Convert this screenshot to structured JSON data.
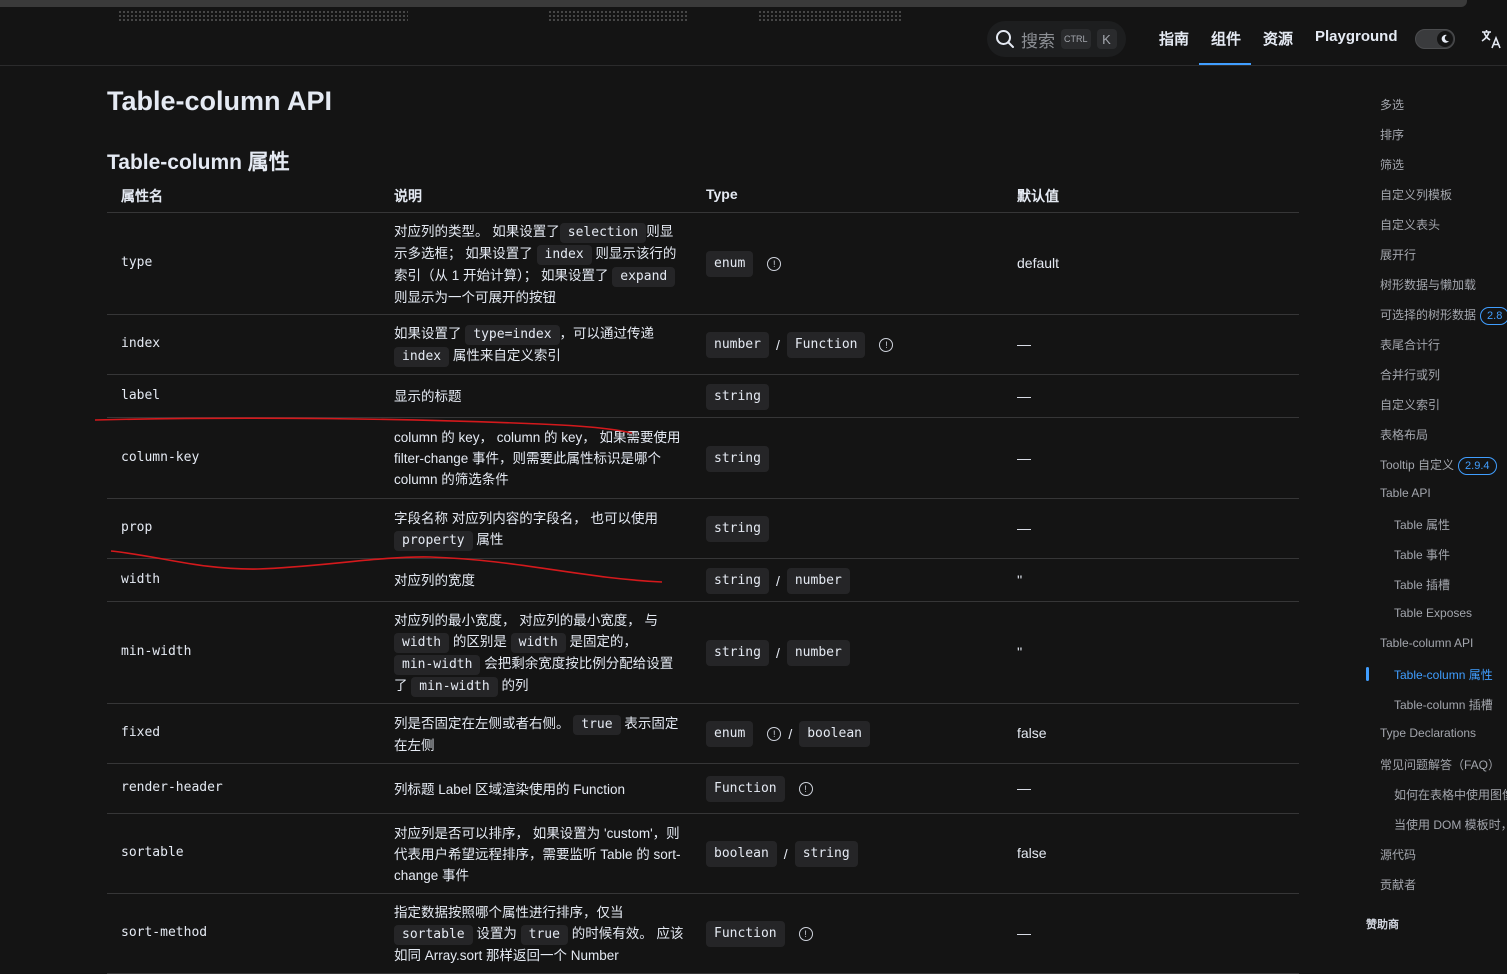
{
  "nav": {
    "search_placeholder": "搜索",
    "kbd_ctrl": "CTRL",
    "kbd_k": "K",
    "items": [
      "指南",
      "组件",
      "资源",
      "Playground"
    ],
    "active_index": 1
  },
  "page": {
    "title": "Table-column API",
    "section": "Table-column 属性"
  },
  "table": {
    "headers": [
      "属性名",
      "说明",
      "Type",
      "默认值"
    ],
    "rows": [
      {
        "name": "type",
        "desc": [
          [
            "对应列的类型。 如果设置了",
            {
              "code": "selection"
            },
            "则显示多选框； 如果设置了 ",
            {
              "code": "index"
            },
            " 则显示该行的索引（从 1 开始计算）； 如果设置了 ",
            {
              "code": "expand"
            },
            " 则显示为一个可展开的按钮"
          ]
        ],
        "types": [
          {
            "code": "enum",
            "info": true
          }
        ],
        "default": "default"
      },
      {
        "name": "index",
        "desc": [
          [
            "如果设置了 ",
            {
              "code": "type=index"
            },
            "，可以通过传递 ",
            {
              "code": "index"
            },
            " 属性来自定义索引"
          ]
        ],
        "types": [
          {
            "code": "number"
          },
          {
            "code": "Function",
            "info": true
          }
        ],
        "default": "—"
      },
      {
        "name": "label",
        "desc": [
          [
            "显示的标题"
          ]
        ],
        "types": [
          {
            "code": "string"
          }
        ],
        "default": "—"
      },
      {
        "name": "column-key",
        "desc": [
          [
            "column 的 key， column 的 key， 如果需要使用 filter-change 事件，则需要此属性标识是哪个 column 的筛选条件"
          ]
        ],
        "types": [
          {
            "code": "string"
          }
        ],
        "default": "—"
      },
      {
        "name": "prop",
        "desc": [
          [
            "字段名称 对应列内容的字段名， 也可以使用 ",
            {
              "code": "property"
            },
            " 属性"
          ]
        ],
        "types": [
          {
            "code": "string"
          }
        ],
        "default": "—"
      },
      {
        "name": "width",
        "desc": [
          [
            "对应列的宽度"
          ]
        ],
        "types": [
          {
            "code": "string"
          },
          {
            "code": "number"
          }
        ],
        "default": "''"
      },
      {
        "name": "min-width",
        "desc": [
          [
            "对应列的最小宽度， 对应列的最小宽度， 与 ",
            {
              "code": "width"
            },
            " 的区别是 ",
            {
              "code": "width"
            },
            " 是固定的，",
            {
              "code": "min-width"
            },
            " 会把剩余宽度按比例分配给设置了 ",
            {
              "code": "min-width"
            },
            " 的列"
          ]
        ],
        "types": [
          {
            "code": "string"
          },
          {
            "code": "number"
          }
        ],
        "default": "''"
      },
      {
        "name": "fixed",
        "desc": [
          [
            "列是否固定在左侧或者右侧。 ",
            {
              "code": "true"
            },
            " 表示固定在左侧"
          ]
        ],
        "types": [
          {
            "code": "enum",
            "info": true
          },
          {
            "code": "boolean"
          }
        ],
        "default": "false"
      },
      {
        "name": "render-header",
        "desc": [
          [
            "列标题 Label 区域渲染使用的 Function"
          ]
        ],
        "types": [
          {
            "code": "Function",
            "info": true
          }
        ],
        "default": "—"
      },
      {
        "name": "sortable",
        "desc": [
          [
            "对应列是否可以排序， 如果设置为 'custom'，则代表用户希望远程排序，需要监听 Table 的 sort-change 事件"
          ]
        ],
        "types": [
          {
            "code": "boolean"
          },
          {
            "code": "string"
          }
        ],
        "default": "false"
      },
      {
        "name": "sort-method",
        "desc": [
          [
            "指定数据按照哪个属性进行排序，仅当 ",
            {
              "code": "sortable"
            },
            " 设置为 ",
            {
              "code": "true"
            },
            " 的时候有效。 应该如同 Array.sort 那样返回一个 Number"
          ]
        ],
        "types": [
          {
            "code": "Function",
            "info": true
          }
        ],
        "default": "—"
      }
    ]
  },
  "aside": {
    "items": [
      {
        "label": "多选",
        "level": 1
      },
      {
        "label": "排序",
        "level": 1
      },
      {
        "label": "筛选",
        "level": 1
      },
      {
        "label": "自定义列模板",
        "level": 1
      },
      {
        "label": "自定义表头",
        "level": 1
      },
      {
        "label": "展开行",
        "level": 1
      },
      {
        "label": "树形数据与懒加载",
        "level": 1
      },
      {
        "label": "可选择的树形数据",
        "level": 1,
        "badge": "2.8"
      },
      {
        "label": "表尾合计行",
        "level": 1
      },
      {
        "label": "合并行或列",
        "level": 1
      },
      {
        "label": "自定义索引",
        "level": 1
      },
      {
        "label": "表格布局",
        "level": 1
      },
      {
        "label": "Tooltip 自定义",
        "level": 1,
        "badge": "2.9.4"
      },
      {
        "label": "Table API",
        "level": 1
      },
      {
        "label": "Table 属性",
        "level": 2
      },
      {
        "label": "Table 事件",
        "level": 2
      },
      {
        "label": "Table 插槽",
        "level": 2
      },
      {
        "label": "Table Exposes",
        "level": 2
      },
      {
        "label": "Table-column API",
        "level": 1
      },
      {
        "label": "Table-column 属性",
        "level": 2,
        "active": true
      },
      {
        "label": "Table-column 插槽",
        "level": 2
      },
      {
        "label": "Type Declarations",
        "level": 1
      },
      {
        "label": "常见问题解答（FAQ）",
        "level": 1
      },
      {
        "label": "如何在表格中使用图像",
        "level": 2
      },
      {
        "label": "当使用 DOM 模板时，",
        "level": 2
      },
      {
        "label": "源代码",
        "level": 1
      },
      {
        "label": "贡献者",
        "level": 1
      }
    ],
    "sponsor": "赞助商"
  },
  "colors": {
    "accent": "#409eff",
    "background": "#141414",
    "annotation": "#d4191c"
  }
}
